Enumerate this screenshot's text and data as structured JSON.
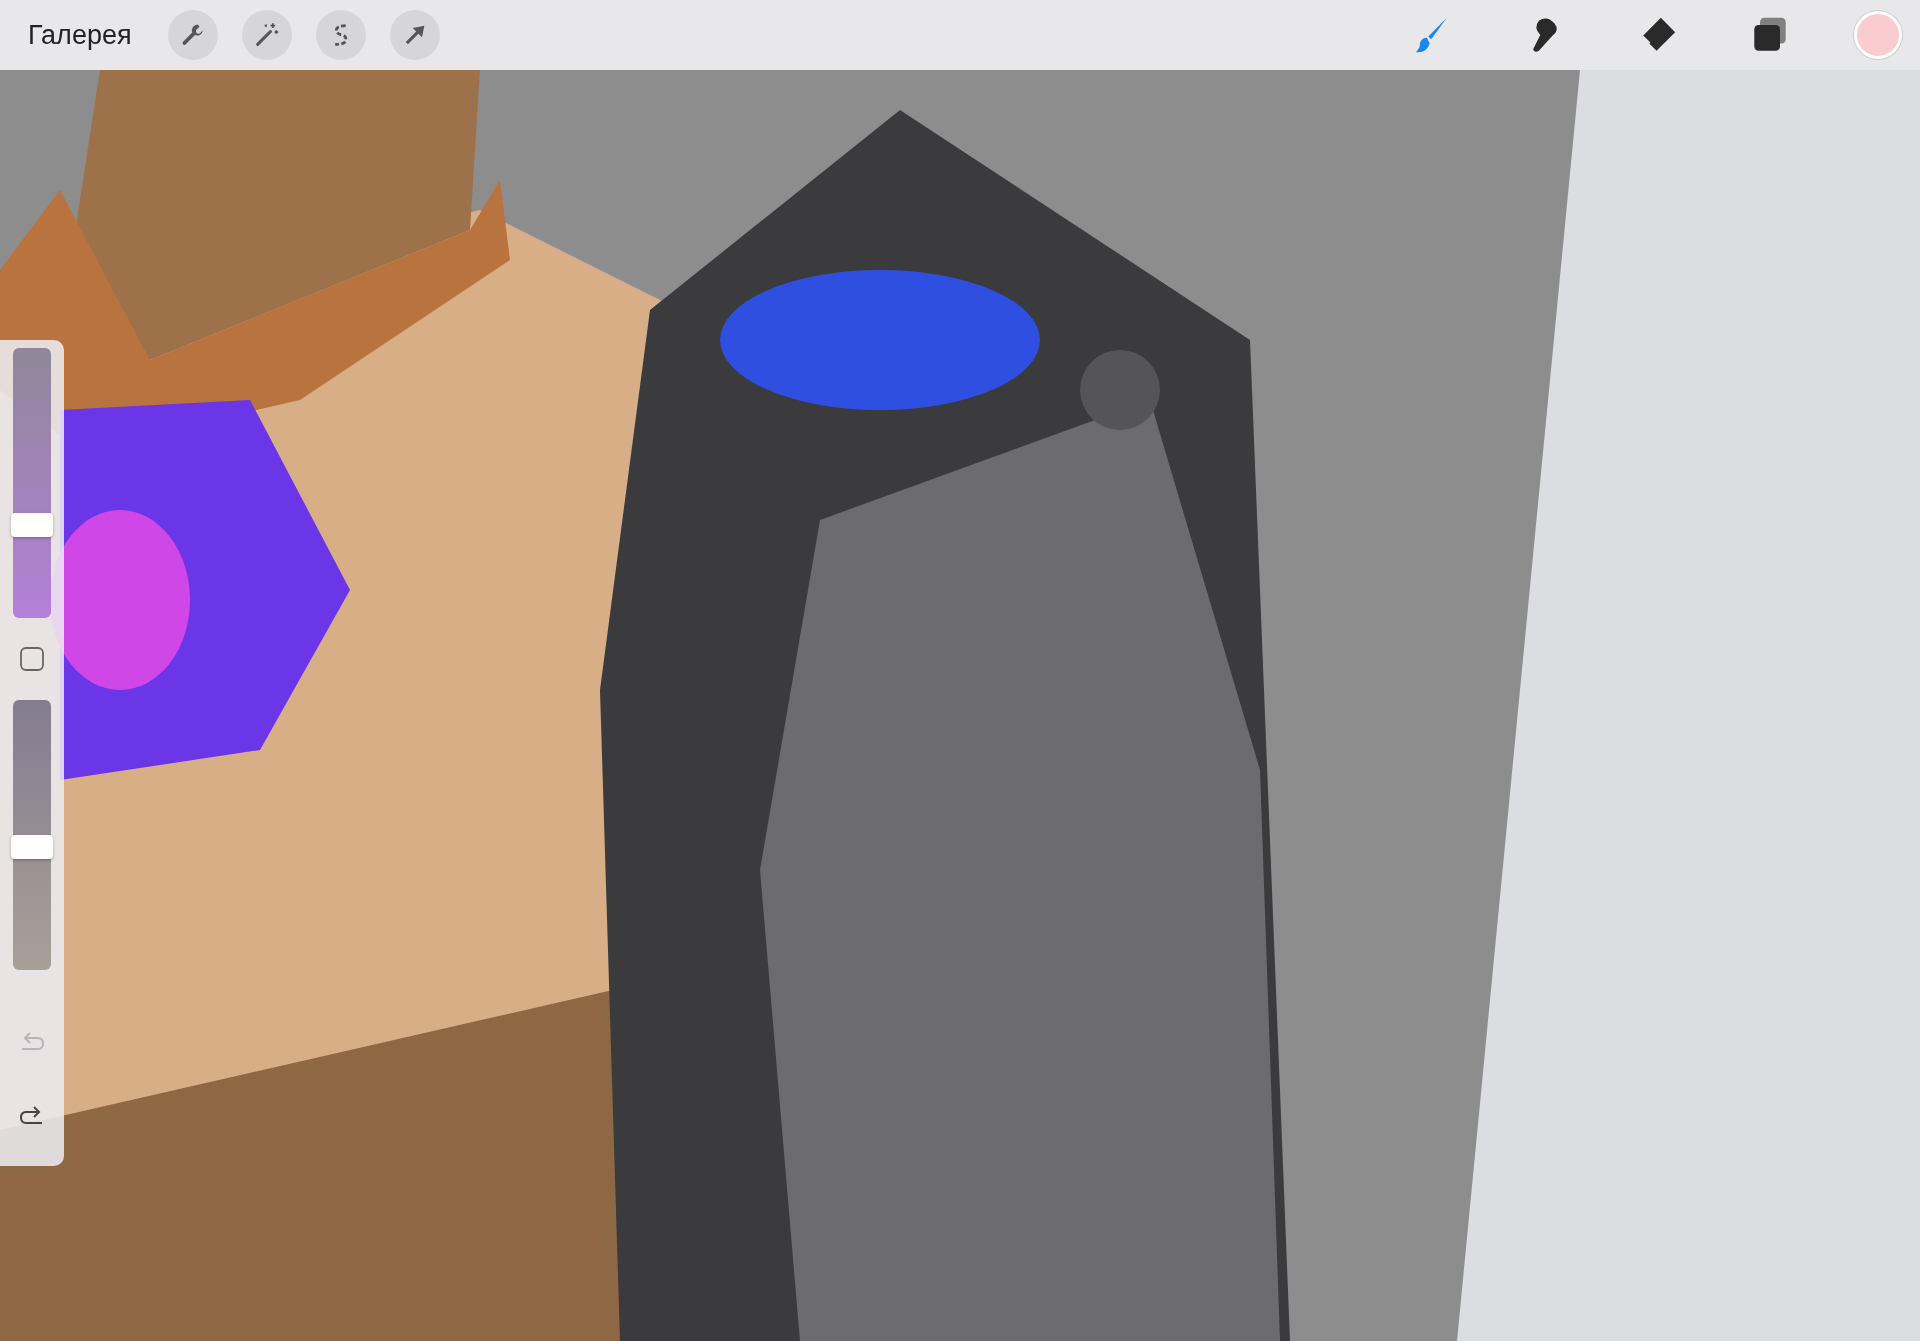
{
  "top_bar": {
    "gallery": "Галерея",
    "actions": [
      {
        "kind": "wrench"
      },
      {
        "kind": "wand"
      },
      {
        "kind": "selection"
      },
      {
        "kind": "arrow"
      }
    ],
    "tools": [
      {
        "kind": "brush",
        "selected": true
      },
      {
        "kind": "smudge",
        "selected": false
      },
      {
        "kind": "eraser",
        "selected": false
      },
      {
        "kind": "layers",
        "selected": false
      }
    ],
    "current_color": {
      "color": "#f9cdd0"
    }
  },
  "sidebar": {
    "brush_size": {
      "level": 0.33
    },
    "opacity": {
      "level": 0.45
    },
    "undo": {
      "disabled": true
    },
    "redo": {
      "disabled": false
    }
  }
}
